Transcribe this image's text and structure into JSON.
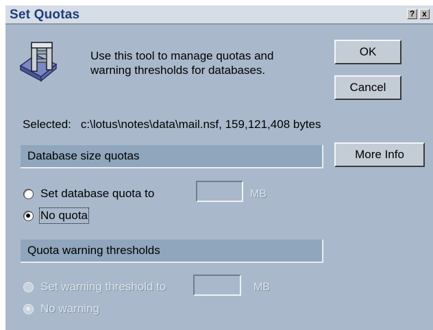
{
  "window": {
    "title": "Set Quotas",
    "help_glyph": "?",
    "close_glyph": "x"
  },
  "description": {
    "line1": "Use this tool to manage quotas and",
    "line2": "warning thresholds for databases."
  },
  "buttons": {
    "ok": "OK",
    "cancel": "Cancel",
    "more_info": "More Info"
  },
  "selected": {
    "label": "Selected:",
    "value": "c:\\lotus\\notes\\data\\mail.nsf, 159,121,408 bytes"
  },
  "size_quotas": {
    "header": "Database size quotas",
    "set_option": "Set database quota to",
    "unit": "MB",
    "quota_value": "",
    "no_option": "No quota",
    "selected": "No quota"
  },
  "warning": {
    "header": "Quota warning thresholds",
    "set_option": "Set warning threshold to",
    "unit": "MB",
    "threshold_value": "",
    "no_option": "No warning",
    "selected": "No warning",
    "enabled": false
  },
  "colors": {
    "dialog_bg": "#a9b9cb",
    "section_bg": "#8fa6bc",
    "title_text": "#1e3e78"
  }
}
